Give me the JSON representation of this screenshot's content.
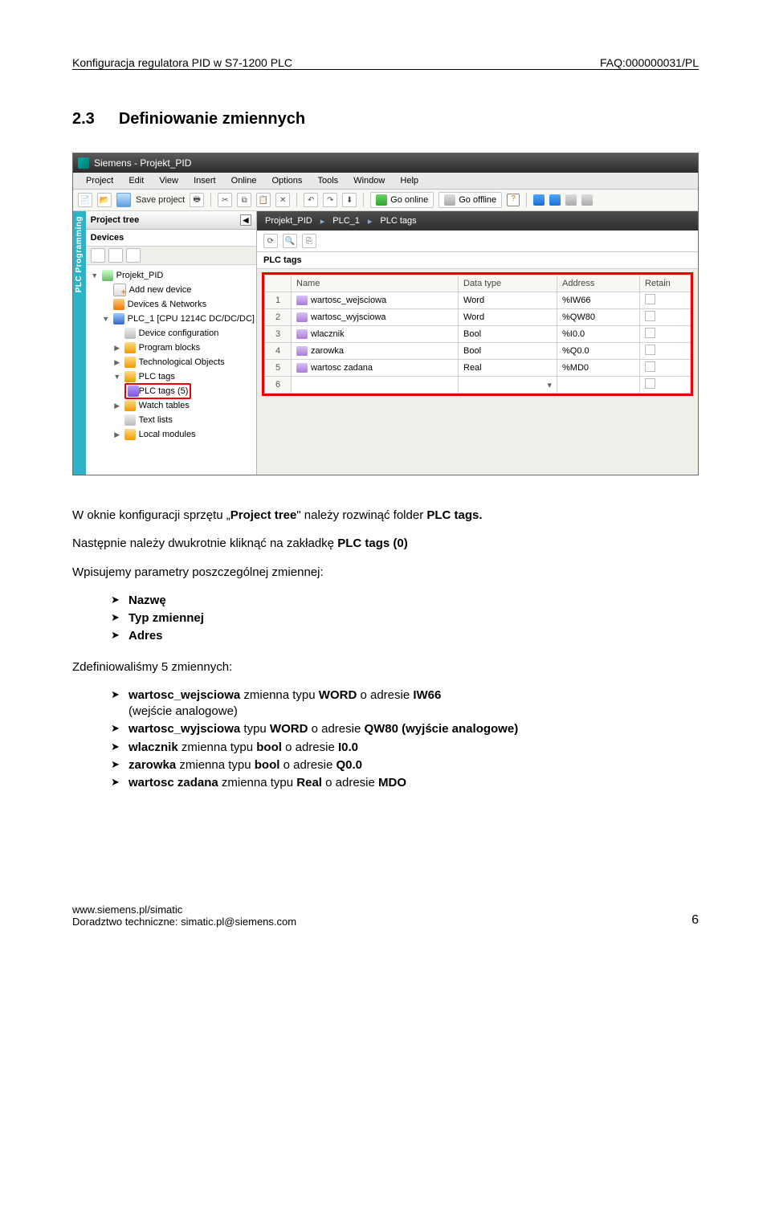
{
  "header": {
    "left": "Konfiguracja regulatora PID w S7-1200 PLC",
    "right": "FAQ:000000031/PL"
  },
  "section": {
    "num": "2.3",
    "title": "Definiowanie zmiennych"
  },
  "shot": {
    "titlebar": "Siemens  -  Projekt_PID",
    "menu": [
      "Project",
      "Edit",
      "View",
      "Insert",
      "Online",
      "Options",
      "Tools",
      "Window",
      "Help"
    ],
    "toolbar": {
      "save": "Save project",
      "goOnline": "Go online",
      "goOffline": "Go offline"
    },
    "projectTree": {
      "title": "Project tree",
      "devices": "Devices",
      "ribbon": "PLC Programming"
    },
    "tree": [
      "Projekt_PID",
      "Add new device",
      "Devices & Networks",
      "PLC_1 [CPU 1214C DC/DC/DC]",
      "Device configuration",
      "Program blocks",
      "Technological Objects",
      "PLC tags",
      "PLC tags (5)",
      "Watch tables",
      "Text lists",
      "Local modules"
    ],
    "breadcrumb": [
      "Projekt_PID",
      "PLC_1",
      "PLC tags"
    ],
    "tableTitle": "PLC tags",
    "cols": [
      "",
      "Name",
      "Data type",
      "Address",
      "Retain"
    ],
    "rows": [
      {
        "n": "1",
        "name": "wartosc_wejsciowa",
        "type": "Word",
        "addr": "%IW66"
      },
      {
        "n": "2",
        "name": "wartosc_wyjsciowa",
        "type": "Word",
        "addr": "%QW80"
      },
      {
        "n": "3",
        "name": "wlacznik",
        "type": "Bool",
        "addr": "%I0.0"
      },
      {
        "n": "4",
        "name": "zarowka",
        "type": "Bool",
        "addr": "%Q0.0"
      },
      {
        "n": "5",
        "name": "wartosc zadana",
        "type": "Real",
        "addr": "%MD0"
      },
      {
        "n": "6",
        "name": "",
        "type": "",
        "addr": ""
      }
    ]
  },
  "body": {
    "p1a": "W oknie konfiguracji sprzętu „",
    "p1b": "Project tree",
    "p1c": "\" należy rozwinąć folder ",
    "p1d": "PLC tags.",
    "p2a": "Następnie należy dwukrotnie kliknąć na zakładkę ",
    "p2b": "PLC tags (0)",
    "p3": "Wpisujemy parametry poszczególnej zmiennej:",
    "b1": [
      "Nazwę",
      "Typ zmiennej",
      "Adres"
    ],
    "p4": "Zdefiniowaliśmy 5 zmiennych:",
    "b2": [
      {
        "t": "wartosc_wejsciowa zmienna typu WORD o adresie IW66",
        "sub": "(wejście analogowe)",
        "bold": [
          "wartosc_wejsciowa",
          "WORD",
          "IW66"
        ]
      },
      {
        "t": "wartosc_wyjsciowa typu WORD o adresie QW80 (wyjście analogowe)",
        "bold": [
          "wartosc_wyjsciowa",
          "WORD",
          "QW80 (wyjście analogowe)"
        ]
      },
      {
        "t": "wlacznik zmienna typu bool o adresie I0.0",
        "bold": [
          "wlacznik",
          "bool",
          "I0.0"
        ]
      },
      {
        "t": "zarowka zmienna typu bool o adresie Q0.0",
        "bold": [
          "zarowka",
          "bool",
          "Q0.0"
        ]
      },
      {
        "t": "wartosc zadana zmienna typu Real o adresie MDO",
        "bold": [
          "wartosc zadana",
          "Real",
          "MDO"
        ]
      }
    ]
  },
  "footer": {
    "l1": "www.siemens.pl/simatic",
    "l2": "Doradztwo techniczne: simatic.pl@siemens.com",
    "page": "6"
  }
}
